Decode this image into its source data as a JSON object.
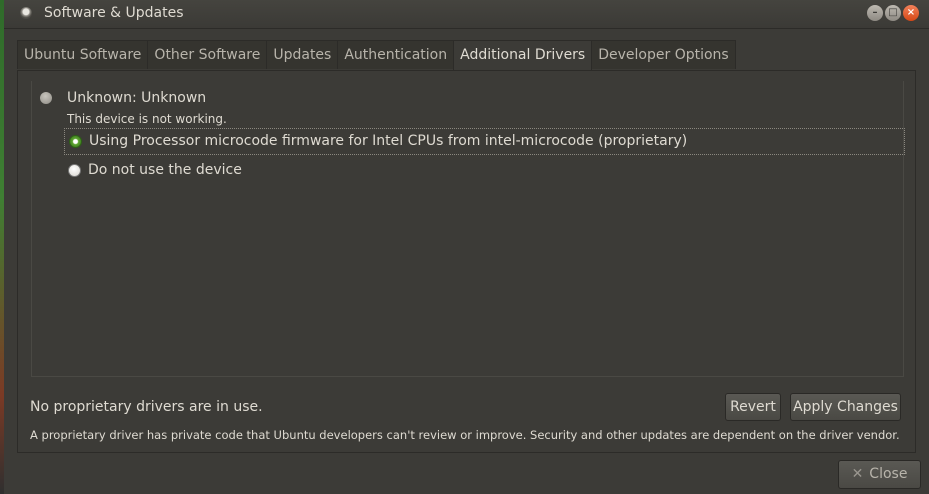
{
  "window": {
    "title": "Software & Updates",
    "icon": "app-icon",
    "controls": {
      "minimize": "–",
      "maximize": "□",
      "close": "×"
    }
  },
  "tabs": [
    {
      "label": "Ubuntu Software",
      "active": false
    },
    {
      "label": "Other Software",
      "active": false
    },
    {
      "label": "Updates",
      "active": false
    },
    {
      "label": "Authentication",
      "active": false
    },
    {
      "label": "Additional Drivers",
      "active": true
    },
    {
      "label": "Developer Options",
      "active": false
    }
  ],
  "device": {
    "name": "Unknown: Unknown",
    "status": "This device is not working.",
    "options": [
      {
        "label": "Using Processor microcode firmware for Intel CPUs from intel-microcode (proprietary)",
        "selected": true
      },
      {
        "label": "Do not use the device",
        "selected": false
      }
    ]
  },
  "footer": {
    "status": "No proprietary drivers are in use.",
    "revert_label": "Revert",
    "apply_label": "Apply Changes",
    "note": "A proprietary driver has private code that Ubuntu developers can't review or improve. Security and other updates are dependent on the driver vendor."
  },
  "close_label": "Close",
  "colors": {
    "accent": "#5fa631",
    "close_button": "#e05a26",
    "background": "#3c3b37"
  }
}
